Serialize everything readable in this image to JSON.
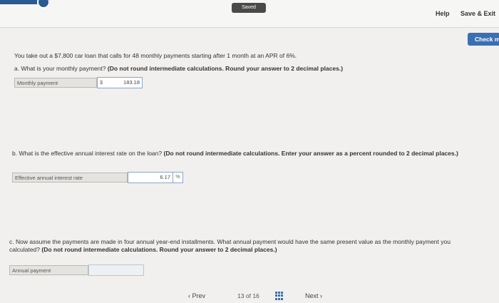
{
  "header": {
    "saved_label": "Saved",
    "help_label": "Help",
    "save_exit_label": "Save & Exit",
    "check_label": "Check m"
  },
  "question": {
    "intro": "You take out a $7,800 car loan that calls for 48 monthly payments starting after 1 month at an APR of 6%.",
    "part_a": {
      "prefix": "a. What is your monthly payment?",
      "instruction": "(Do not round intermediate calculations. Round your answer to 2 decimal places.)",
      "field_label": "Monthly payment",
      "currency_symbol": "$",
      "value": "183.18"
    },
    "part_b": {
      "prefix": "b. What is the effective annual interest rate on the loan?",
      "instruction": "(Do not round intermediate calculations. Enter your answer as a percent rounded to 2 decimal places.)",
      "field_label": "Effective annual interest rate",
      "value": "6.17",
      "unit": "%"
    },
    "part_c": {
      "prefix": "c. Now assume the payments are made in four annual year-end installments. What annual payment would have the same present value as the monthly payment you calculated?",
      "instruction": "(Do not round intermediate calculations. Round your answer to 2 decimal places.)",
      "field_label": "Annual payment",
      "value": ""
    }
  },
  "navigation": {
    "prev_label": "Prev",
    "page_current": "13",
    "page_of": "of",
    "page_total": "16",
    "next_label": "Next"
  }
}
